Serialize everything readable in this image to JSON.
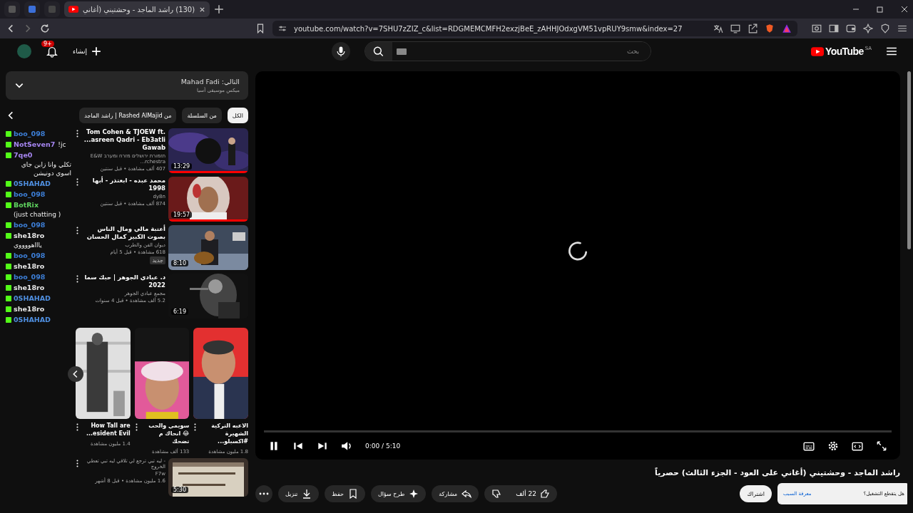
{
  "browser": {
    "tabs": [
      {
        "kind": "pinned",
        "selected": false
      },
      {
        "kind": "pinned",
        "selected": false
      },
      {
        "kind": "pinned",
        "selected": false
      },
      {
        "kind": "page",
        "title": "(130) راشد الماجد - وحشتيني (أغاني",
        "selected": true
      }
    ],
    "url": "youtube.com/watch?v=7SHU7zZIZ_c&list=RDGMEMCMFH2exzjBeE_zAHHJOdxgVM51vpRUY9smw&index=27"
  },
  "header": {
    "create": "إنشاء",
    "notifications": "9+",
    "search": {
      "placeholder": "بحث"
    },
    "logo": "YouTube",
    "region": "SA"
  },
  "playlist": {
    "next": "التالي: Mahad Fadi",
    "subtitle": "ميكس موسيقى أسيا",
    "chips": [
      {
        "label": "الكل",
        "selected": true
      },
      {
        "label": "من السلسلة",
        "selected": false
      },
      {
        "label": "من Rashed AlMajid | راشد الماجد",
        "selected": false
      }
    ],
    "videos": [
      {
        "title": "Tom Cohen & TJOEW ft. ...asreen Qadri - Eb3atli Gawab",
        "channel": "תזמורת ירושלים מזרח ומערב E&W ...rchestra",
        "meta": "407 ألف مشاهدة • قبل سنتين",
        "duration": "13:29",
        "level": 1
      },
      {
        "title": "محمد عبده - ابعتذر - أبها 1998",
        "channel": "dy8n",
        "meta": "874 ألف مشاهدة • قبل سنتين",
        "duration": "19:57",
        "level": 1
      },
      {
        "title": "أعتبة مالي ومال الناس بصوت الكبير كمال الحسان",
        "channel": "ديوان الفن والطرب",
        "meta": "618 مشاهدة • قبل 5 أيام",
        "badge": "جديد",
        "duration": "8:10"
      },
      {
        "title": "د. عبادي الجوهر | حبك سما 2022",
        "channel": "مجمع عبادي الجوهر",
        "meta": "5.2 ألف مشاهدة • قبل 4 سنوات",
        "duration": "6:19"
      }
    ],
    "shorts": [
      {
        "title": "الاعبه التركية الشهيرة #اكسبلو...",
        "views": "1.8 مليون مشاهدة"
      },
      {
        "title": "سويمي والحب 😂 انحاك م تضحك",
        "views": "133 ألف مشاهدة"
      },
      {
        "title": "How Tall are ...esident Evil",
        "views": "1.4 مليون مشاهدة"
      }
    ],
    "last": {
      "title": "- ليه تبي ترجع لي تلاقي ليه تبي تعطي الخروج",
      "channel": "F7w",
      "meta": "1.6 مليون مشاهدة • قبل 8 أشهر",
      "duration": "5:30"
    }
  },
  "chat": [
    {
      "user": "boo_098",
      "color": "#3d7fd8"
    },
    {
      "user": "NotSeven7",
      "color": "#a585f0",
      "message": "!jc"
    },
    {
      "user": "7qe0",
      "color": "#a585f0",
      "message": "تكلي وانا زابن جاي اسوي دونيشن"
    },
    {
      "user": "0SHAHAD",
      "color": "#4f8fe0"
    },
    {
      "user": "boo_098",
      "color": "#3d7fd8"
    },
    {
      "user": "BotRix",
      "color": "#5fd35f",
      "message": "(just chatting )"
    },
    {
      "user": "boo_098",
      "color": "#3d7fd8"
    },
    {
      "user": "she18ro",
      "color": "#e8e8e8",
      "message": "ياااهووووي"
    },
    {
      "user": "boo_098",
      "color": "#3d7fd8"
    },
    {
      "user": "she18ro",
      "color": "#e8e8e8"
    },
    {
      "user": "boo_098",
      "color": "#3d7fd8"
    },
    {
      "user": "she18ro",
      "color": "#e8e8e8"
    },
    {
      "user": "0SHAHAD",
      "color": "#4f8fe0"
    },
    {
      "user": "she18ro",
      "color": "#e8e8e8"
    },
    {
      "user": "0SHAHAD",
      "color": "#4f8fe0"
    }
  ],
  "player": {
    "level": 0,
    "time": "0:00 / 5:10",
    "playing": true
  },
  "video": {
    "title": "راشد الماجد - وحشتيني (أغاني على العود - الجزء الثالث) حصرياً",
    "likes": "22 ألف",
    "actions": [
      {
        "kind": "share",
        "label": "مشاركة"
      },
      {
        "kind": "ask",
        "label": "طرح سؤال"
      },
      {
        "kind": "save",
        "label": "حفظ"
      },
      {
        "kind": "download",
        "label": "تنزيل"
      }
    ],
    "subscribe": "اشتراك",
    "toast": {
      "question": "هل يتقطع التشغيل؟",
      "link": "معرفة السبب"
    }
  }
}
